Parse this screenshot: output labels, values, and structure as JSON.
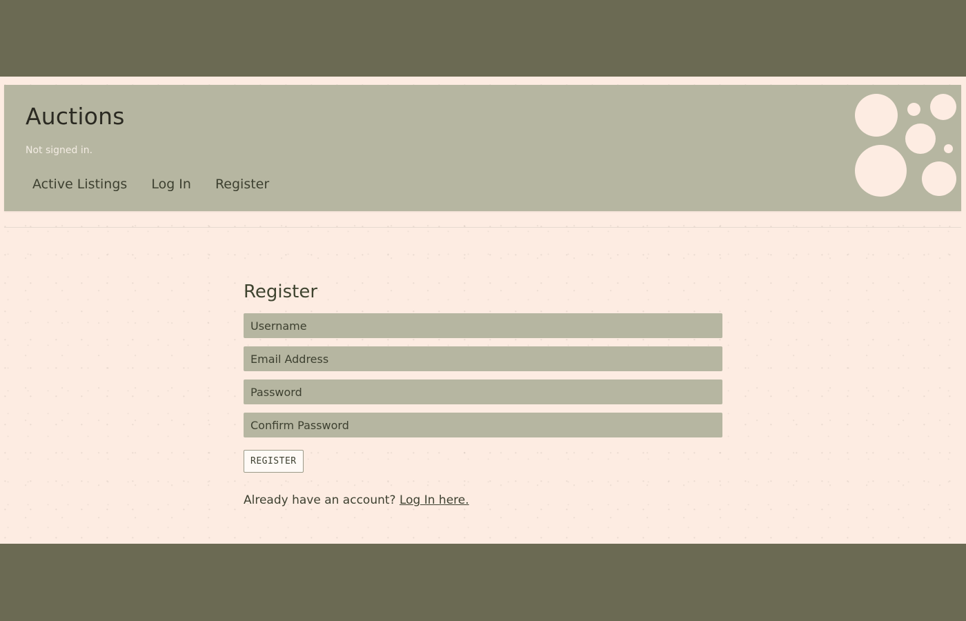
{
  "header": {
    "title": "Auctions",
    "status": "Not signed in.",
    "nav": [
      {
        "label": "Active Listings"
      },
      {
        "label": "Log In"
      },
      {
        "label": "Register"
      }
    ]
  },
  "register_form": {
    "heading": "Register",
    "fields": {
      "username": {
        "placeholder": "Username",
        "value": ""
      },
      "email": {
        "placeholder": "Email Address",
        "value": ""
      },
      "password": {
        "placeholder": "Password",
        "value": ""
      },
      "confirm_password": {
        "placeholder": "Confirm Password",
        "value": ""
      }
    },
    "submit_label": "REGISTER",
    "login_prompt": "Already have an account?",
    "login_link": "Log In here."
  },
  "colors": {
    "page_background": "#fdece2",
    "header_background": "#b6b6a1",
    "frame": "#6b6a53",
    "text": "#3d4030"
  }
}
